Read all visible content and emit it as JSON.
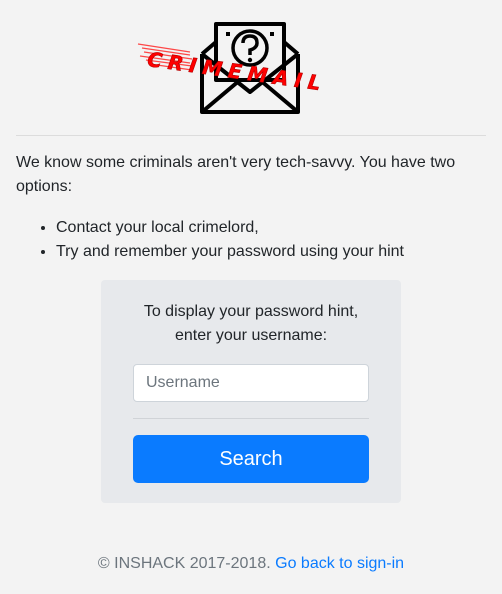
{
  "logo": {
    "text": "CRIMEMAIL",
    "icon": "envelope-question-icon",
    "accent_color": "#ff0000"
  },
  "intro": {
    "text": "We know some criminals aren't very tech-savvy. You have two options:"
  },
  "options": [
    "Contact your local crimelord,",
    "Try and remember your password using your hint"
  ],
  "hint_card": {
    "line1": "To display your password hint,",
    "line2": "enter your username:",
    "username_placeholder": "Username",
    "username_value": "",
    "search_label": "Search"
  },
  "footer": {
    "copyright": "© INSHACK 2017-2018.",
    "link_label": "Go back to sign-in"
  },
  "colors": {
    "background": "#f3f3f3",
    "primary": "#0a7bff",
    "card": "#e7e9ec"
  }
}
